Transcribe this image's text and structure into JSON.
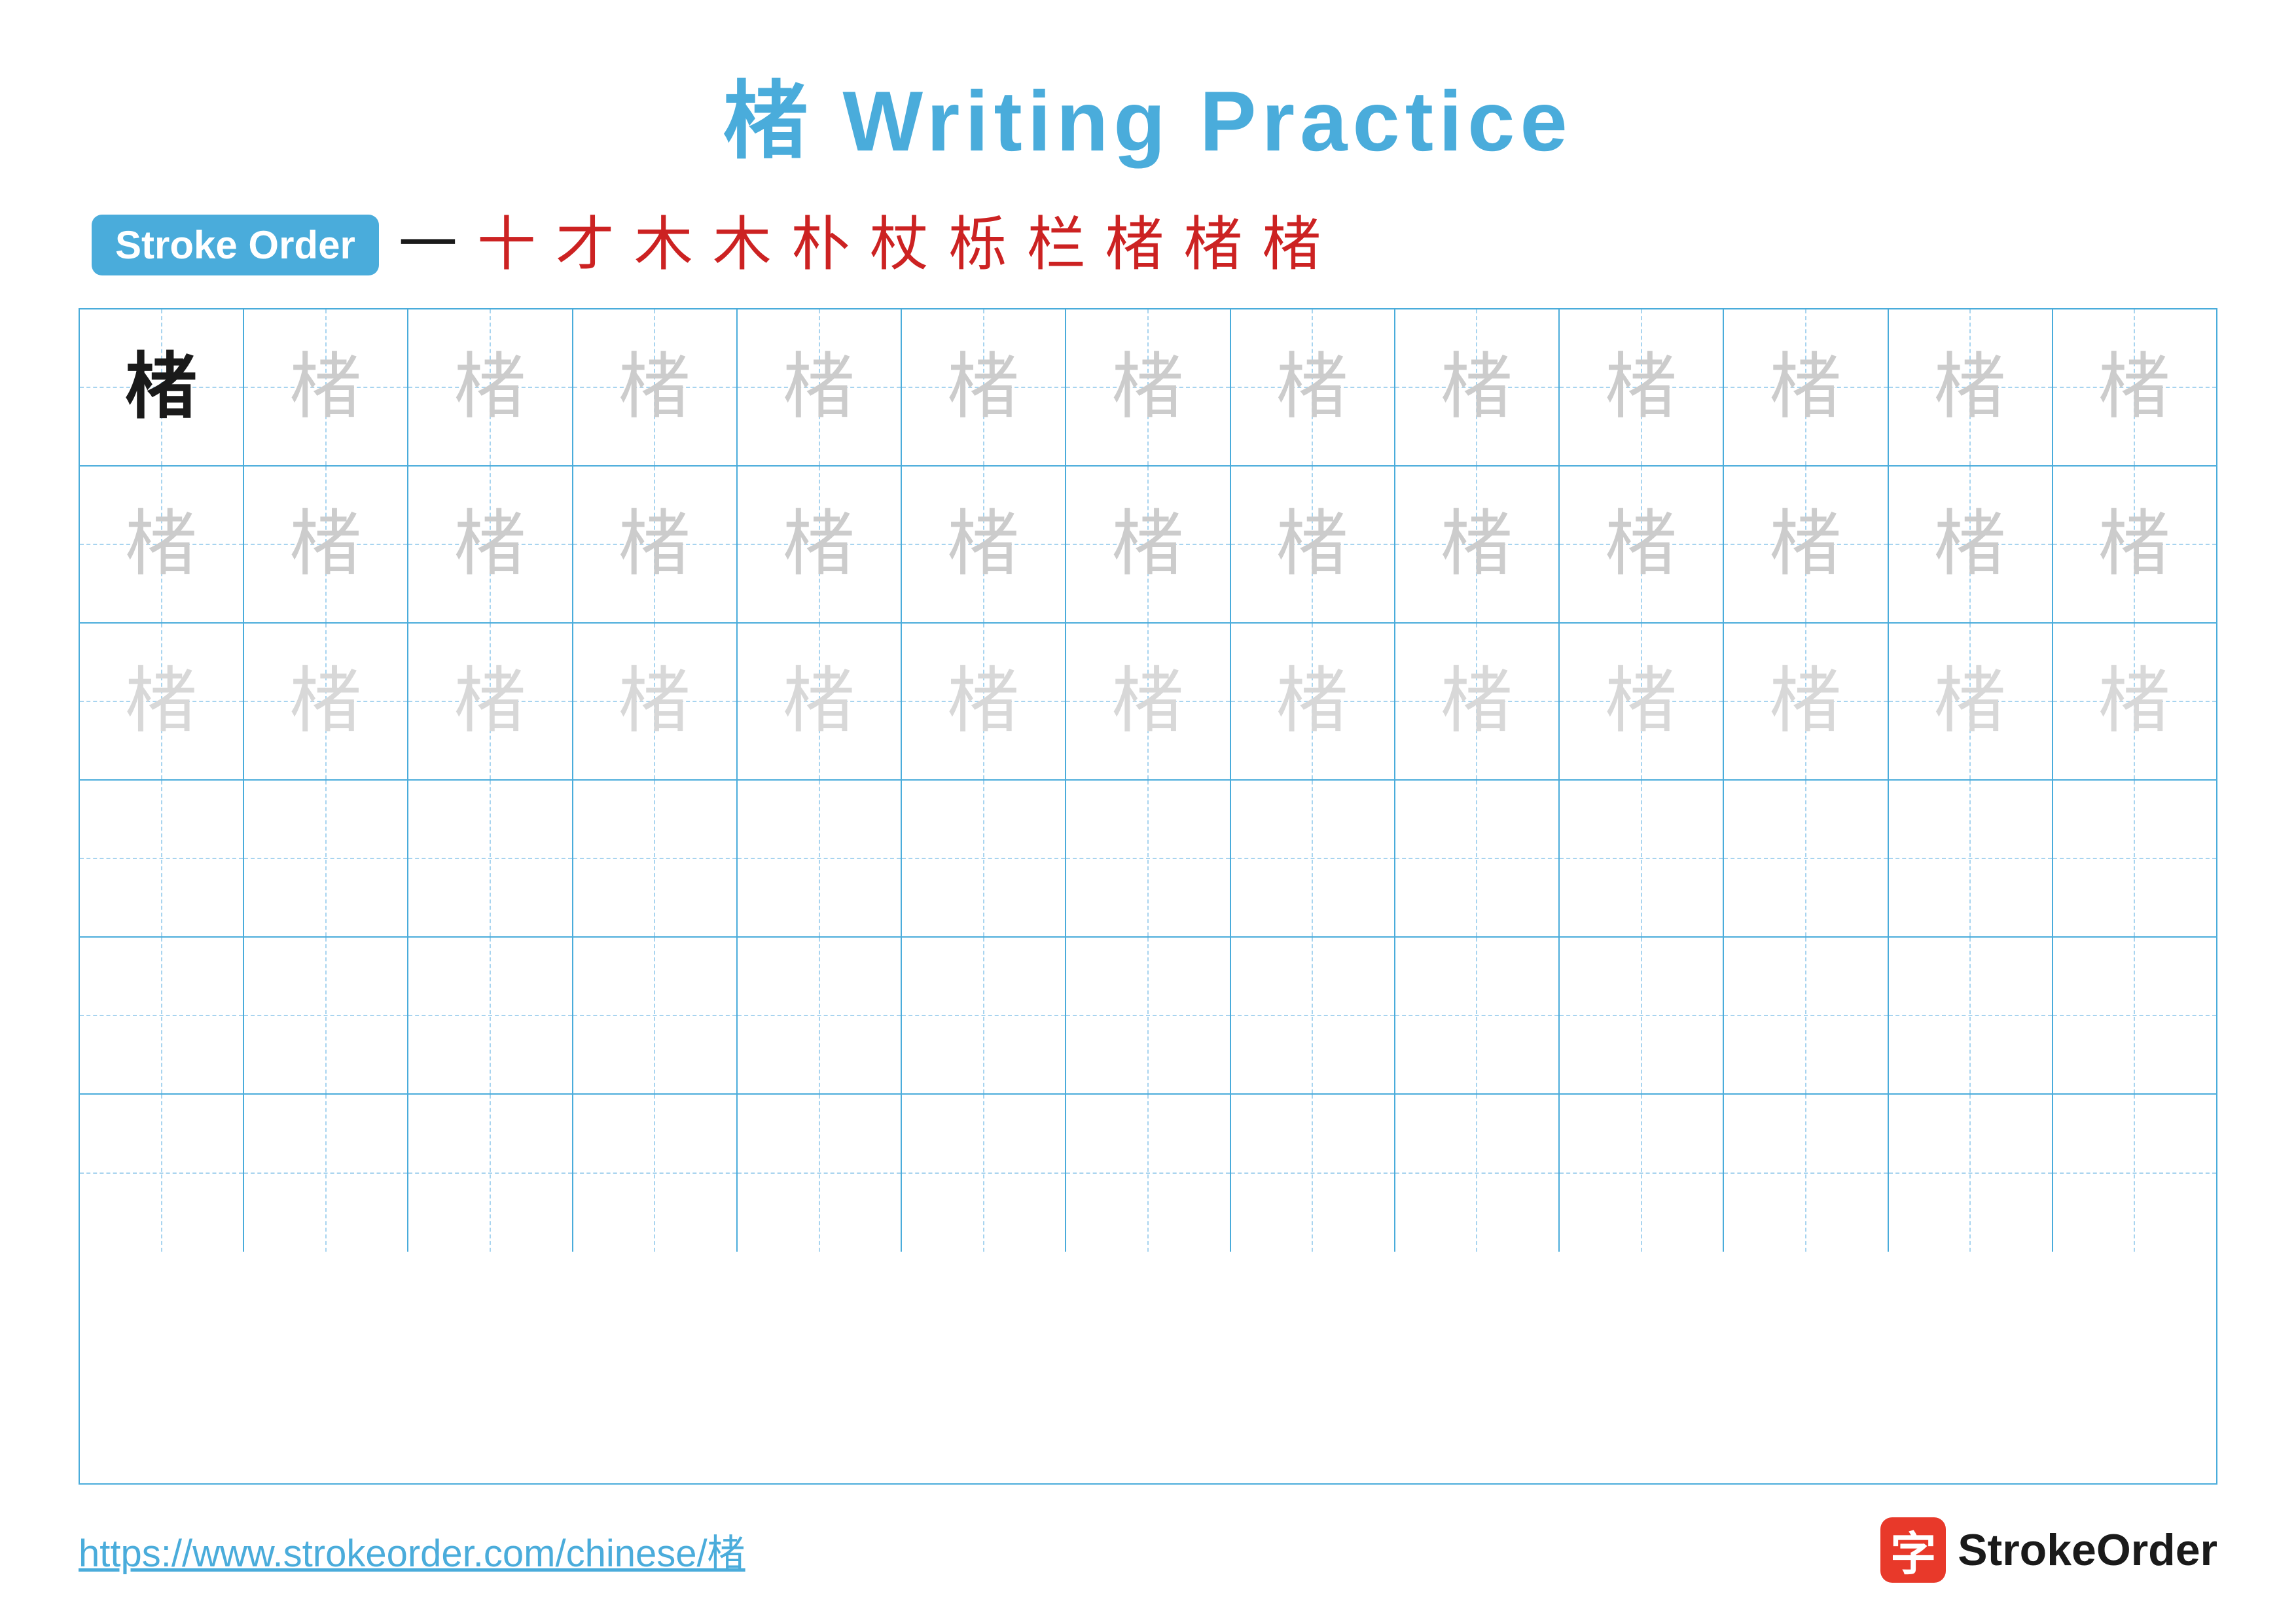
{
  "title": "楮 Writing Practice",
  "stroke_order": {
    "label": "Stroke Order",
    "steps": [
      "一",
      "十",
      "才",
      "木",
      "木",
      "朴",
      "杖",
      "栎",
      "栏",
      "楮",
      "楮",
      "楮"
    ]
  },
  "grid": {
    "rows": 6,
    "cols": 13,
    "char": "楮",
    "row_types": [
      "solid-then-light",
      "light",
      "lighter",
      "empty",
      "empty",
      "empty"
    ]
  },
  "footer": {
    "url": "https://www.strokeorder.com/chinese/楮",
    "brand_name": "StrokeOrder",
    "brand_icon": "字"
  }
}
